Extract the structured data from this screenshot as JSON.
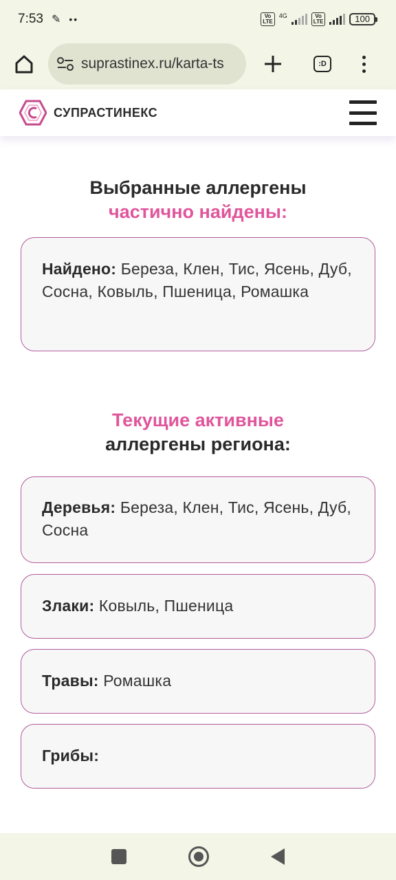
{
  "status": {
    "time": "7:53",
    "network": "4G",
    "volte_label": "Vo LTE",
    "battery": "100"
  },
  "browser": {
    "url": "suprastinex.ru/karta-ts",
    "tabs_label": ":D"
  },
  "site": {
    "brand_name": "СУПРАСТИНЕКС",
    "accent_color": "#e0559b",
    "border_color": "#b05a9c"
  },
  "found_section": {
    "title_line1": "Выбранные аллергены",
    "title_line2": "частично найдены:",
    "card_label": "Найдено:",
    "card_text": "Береза, Клен, Тис, Ясень, Дуб, Сосна, Ковыль, Пшеница, Ромашка"
  },
  "region_section": {
    "title_line1": "Текущие активные",
    "title_line2": "аллергены региона:",
    "cards": [
      {
        "label": "Деревья:",
        "text": "Береза, Клен, Тис, Ясень, Дуб, Сосна"
      },
      {
        "label": "Злаки:",
        "text": "Ковыль, Пшеница"
      },
      {
        "label": "Травы:",
        "text": "Ромашка"
      },
      {
        "label": "Грибы:",
        "text": ""
      }
    ]
  }
}
